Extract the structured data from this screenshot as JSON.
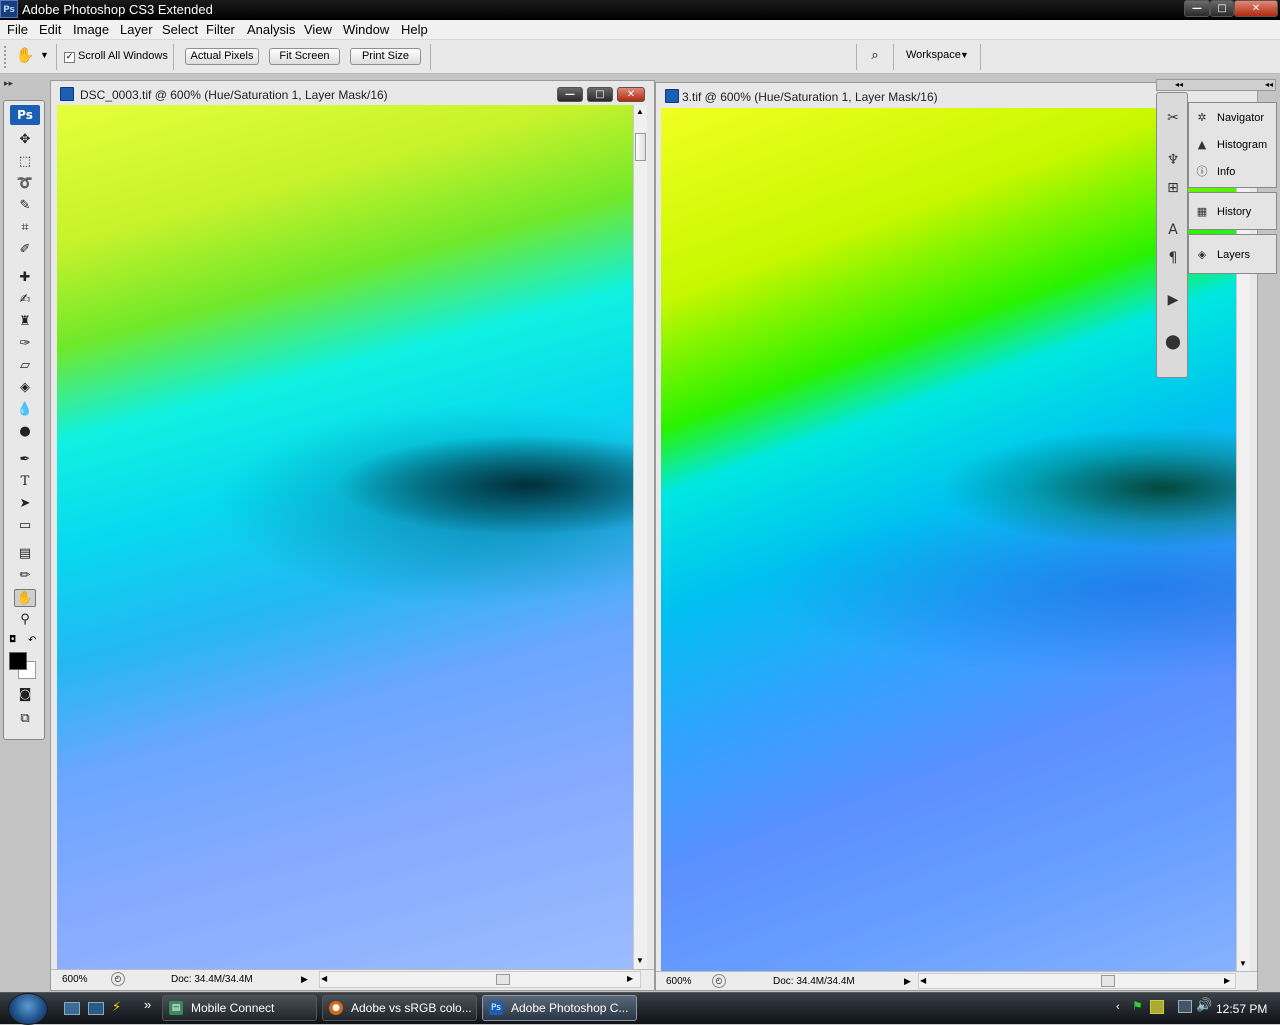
{
  "app": {
    "title": "Adobe Photoshop CS3 Extended",
    "icon_text": "Ps"
  },
  "window_controls": {
    "minimize": "—",
    "maximize": "□",
    "close": "✕"
  },
  "menu": [
    "File",
    "Edit",
    "Image",
    "Layer",
    "Select",
    "Filter",
    "Analysis",
    "View",
    "Window",
    "Help"
  ],
  "options": {
    "scroll_all_windows": "Scroll All Windows",
    "scroll_all_checked": true,
    "actual_pixels": "Actual Pixels",
    "fit_screen": "Fit Screen",
    "print_size": "Print Size",
    "workspace": "Workspace"
  },
  "toolbox": {
    "logo": "Ps",
    "tools": [
      "move",
      "marquee",
      "lasso",
      "magic-wand",
      "crop",
      "slice",
      "healing",
      "brush",
      "stamp",
      "history-brush",
      "eraser",
      "bucket",
      "blur",
      "dodge",
      "pen",
      "type",
      "path-select",
      "shape",
      "notes",
      "eyedropper",
      "hand",
      "zoom"
    ],
    "type_glyph": "T",
    "active_tool": "hand"
  },
  "documents": [
    {
      "title": "DSC_0003.tif @ 600% (Hue/Saturation 1, Layer Mask/16)",
      "zoom": "600%",
      "doc_size": "Doc: 34.4M/34.4M"
    },
    {
      "title": "3.tif @ 600% (Hue/Saturation 1, Layer Mask/16)",
      "zoom": "600%",
      "doc_size": "Doc: 34.4M/34.4M"
    }
  ],
  "panels": {
    "group1": [
      "Navigator",
      "Histogram",
      "Info"
    ],
    "group2": [
      "History"
    ],
    "group3": [
      "Layers"
    ]
  },
  "taskbar": {
    "items": [
      "Mobile Connect",
      "Adobe vs sRGB colo...",
      "Adobe Photoshop C..."
    ],
    "active_index": 2,
    "clock": "12:57 PM",
    "more": "»"
  },
  "colors": {
    "foreground": "#000000",
    "background": "#ffffff",
    "taskbar": "#1a1e24"
  }
}
